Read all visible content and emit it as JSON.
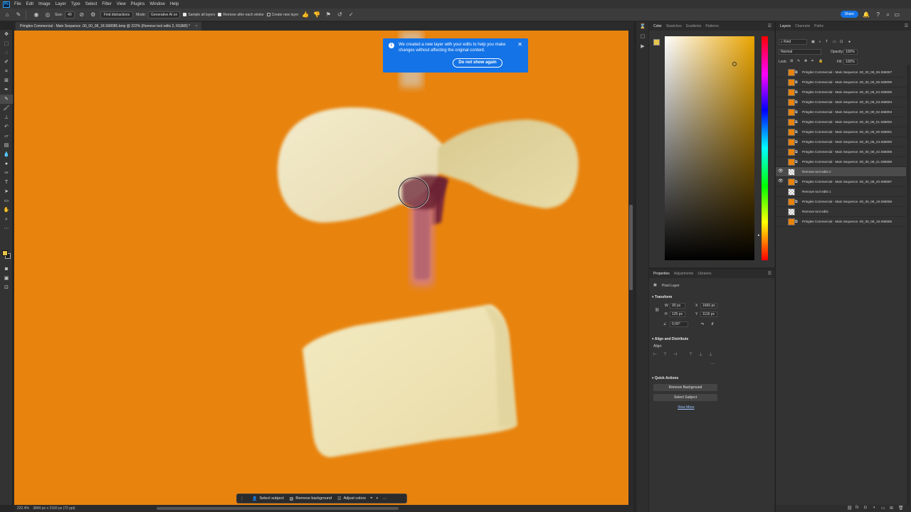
{
  "app": {
    "logo": "Ps",
    "menu": [
      "File",
      "Edit",
      "Image",
      "Layer",
      "Type",
      "Select",
      "Filter",
      "View",
      "Plugins",
      "Window",
      "Help"
    ]
  },
  "options": {
    "size_label": "Size:",
    "size_value": "40",
    "find_distractions": "Find distractions",
    "mode_label": "Mode:",
    "mode_value": "Generative AI on",
    "sample_all_layers": "Sample all layers",
    "remove_after_stroke": "Remove after each stroke",
    "create_new_layer": "Create new layer",
    "share": "Share"
  },
  "document": {
    "tab_title": "Pringles Commercial - Main Sequence .00_00_08_18.S68085.bmp @ 222% (Remove tool edits 2, RGB/8) *",
    "zoom": "222.4%",
    "dimensions": "3840 px x 2160 px (72 ppi)"
  },
  "notification": {
    "message": "We created a new layer with your edits to help you make changes without affecting the original content.",
    "button": "Do not show again"
  },
  "taskbar": {
    "select_subject": "Select subject",
    "remove_background": "Remove background",
    "adjust_colors": "Adjust colors"
  },
  "color_panel": {
    "tabs": [
      "Color",
      "Swatches",
      "Gradients",
      "Patterns"
    ],
    "fg_color": "#e8c44a"
  },
  "properties": {
    "tabs": [
      "Properties",
      "Adjustments",
      "Libraries"
    ],
    "layer_type": "Pixel Layer",
    "transform_title": "Transform",
    "w_label": "W",
    "w_value": "90 px",
    "x_label": "X",
    "x_value": "1666 px",
    "h_label": "H",
    "h_value": "125 px",
    "y_label": "Y",
    "y_value": "1116 px",
    "angle_value": "0.00°",
    "align_title": "Align and Distribute",
    "align_label": "Align:",
    "quick_actions_title": "Quick Actions",
    "remove_background": "Remove Background",
    "select_subject": "Select Subject",
    "view_more": "View More"
  },
  "layers_panel": {
    "tabs": [
      "Layers",
      "Channels",
      "Paths"
    ],
    "filter_kind": "Kind",
    "blend_mode": "Normal",
    "opacity_label": "Opacity:",
    "opacity_value": "100%",
    "lock_label": "Lock:",
    "fill_label": "Fill:",
    "fill_value": "100%",
    "layers": [
      {
        "name": "Pringles Commercial - Main Sequence .00_00_09_06.S68097",
        "visible": false,
        "type": "smart"
      },
      {
        "name": "Pringles Commercial - Main Sequence .00_00_09_05.S68096",
        "visible": false,
        "type": "smart"
      },
      {
        "name": "Pringles Commercial - Main Sequence .00_00_09_04.S68095",
        "visible": false,
        "type": "smart"
      },
      {
        "name": "Pringles Commercial - Main Sequence .00_00_09_03.S68094",
        "visible": false,
        "type": "smart"
      },
      {
        "name": "Pringles Commercial - Main Sequence .00_00_09_02.S68093",
        "visible": false,
        "type": "smart"
      },
      {
        "name": "Pringles Commercial - Main Sequence .00_00_09_01.S68092",
        "visible": false,
        "type": "smart"
      },
      {
        "name": "Pringles Commercial - Main Sequence .00_00_09_00.S68091",
        "visible": false,
        "type": "smart"
      },
      {
        "name": "Pringles Commercial - Main Sequence .00_00_08_23.S68090",
        "visible": false,
        "type": "smart"
      },
      {
        "name": "Pringles Commercial - Main Sequence .00_00_08_22.S68089",
        "visible": false,
        "type": "smart"
      },
      {
        "name": "Pringles Commercial - Main Sequence .00_00_08_21.S68088",
        "visible": false,
        "type": "smart"
      },
      {
        "name": "Remove tool edits 2",
        "visible": true,
        "type": "pixel",
        "selected": true
      },
      {
        "name": "Pringles Commercial - Main Sequence .00_00_08_20.S68087",
        "visible": true,
        "type": "smart"
      },
      {
        "name": "Remove tool edits 1",
        "visible": false,
        "type": "pixel"
      },
      {
        "name": "Pringles Commercial - Main Sequence .00_00_08_19.S68086",
        "visible": false,
        "type": "smart"
      },
      {
        "name": "Remove tool edits",
        "visible": false,
        "type": "pixel"
      },
      {
        "name": "Pringles Commercial - Main Sequence .00_00_08_18.S68085",
        "visible": false,
        "type": "smart"
      }
    ]
  }
}
